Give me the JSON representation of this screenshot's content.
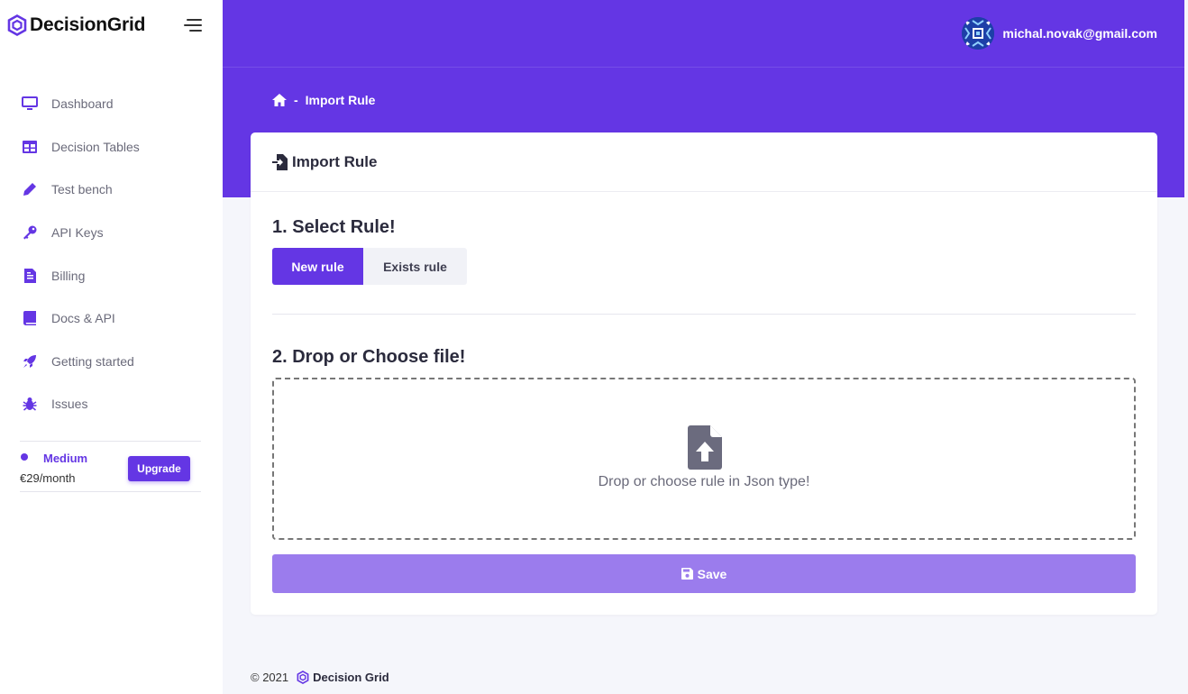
{
  "brand": {
    "name": "DecisionGrid",
    "logo_icon": "hexagon-logo-icon",
    "accent": "#6436e4"
  },
  "header": {
    "user_email": "michal.novak@gmail.com",
    "background": "#6436e4"
  },
  "sidebar": {
    "items": [
      {
        "label": "Dashboard",
        "icon": "monitor-icon"
      },
      {
        "label": "Decision Tables",
        "icon": "table-icon"
      },
      {
        "label": "Test bench",
        "icon": "pen-icon"
      },
      {
        "label": "API Keys",
        "icon": "key-icon"
      },
      {
        "label": "Billing",
        "icon": "document-icon"
      },
      {
        "label": "Docs & API",
        "icon": "book-icon"
      },
      {
        "label": "Getting started",
        "icon": "rocket-icon"
      },
      {
        "label": "Issues",
        "icon": "bug-icon"
      }
    ],
    "plan": {
      "name": "Medium",
      "price": "€29/month",
      "upgrade_label": "Upgrade"
    }
  },
  "breadcrumb": {
    "separator": "-",
    "current": "Import Rule"
  },
  "card": {
    "title": "Import Rule",
    "step1_title": "1. Select Rule!",
    "options": {
      "new_rule": "New rule",
      "exists_rule": "Exists rule",
      "selected": "New rule"
    },
    "step2_title": "2. Drop or Choose file!",
    "drop_text": "Drop or choose rule in Json type!",
    "save_label": "Save"
  },
  "footer": {
    "copyright": "© 2021",
    "brand": "Decision Grid"
  }
}
